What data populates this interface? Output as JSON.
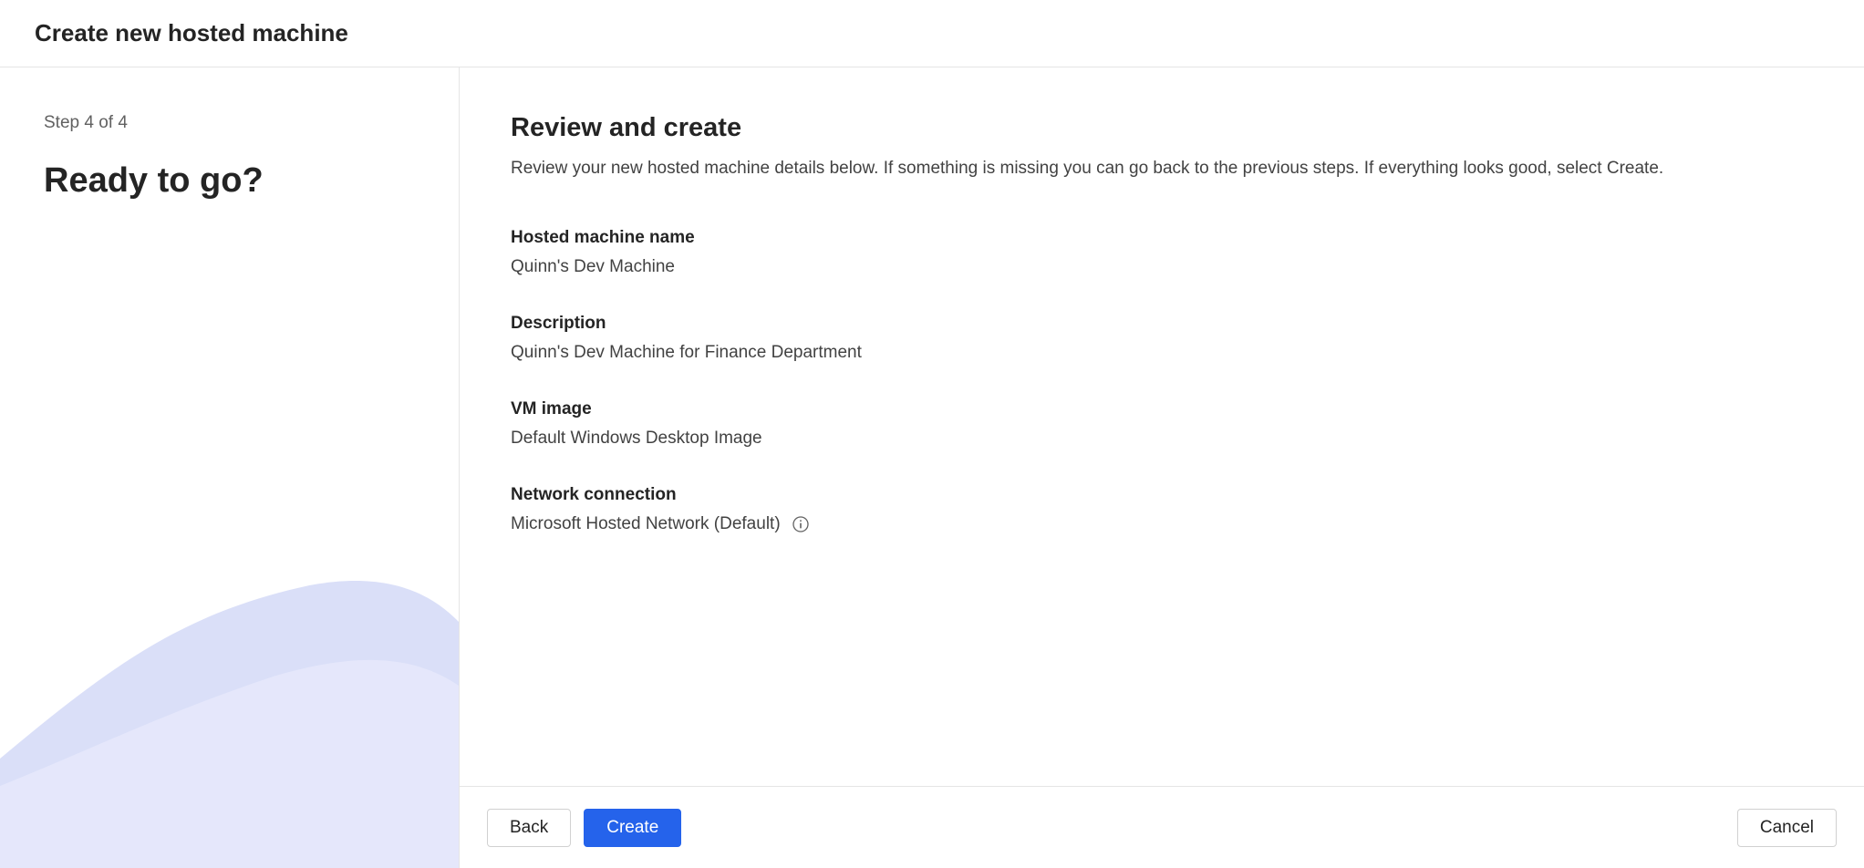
{
  "header": {
    "title": "Create new hosted machine"
  },
  "sidebar": {
    "step_indicator": "Step 4 of 4",
    "heading": "Ready to go?"
  },
  "main": {
    "heading": "Review and create",
    "description": "Review your new hosted machine details below. If something is missing you can go back to the previous steps. If everything looks good, select Create.",
    "review": {
      "machine_name": {
        "label": "Hosted machine name",
        "value": "Quinn's Dev Machine"
      },
      "description": {
        "label": "Description",
        "value": "Quinn's Dev Machine for Finance Department"
      },
      "vm_image": {
        "label": "VM image",
        "value": "Default Windows Desktop Image"
      },
      "network": {
        "label": "Network connection",
        "value": "Microsoft Hosted Network (Default)"
      }
    }
  },
  "footer": {
    "back": "Back",
    "create": "Create",
    "cancel": "Cancel"
  }
}
